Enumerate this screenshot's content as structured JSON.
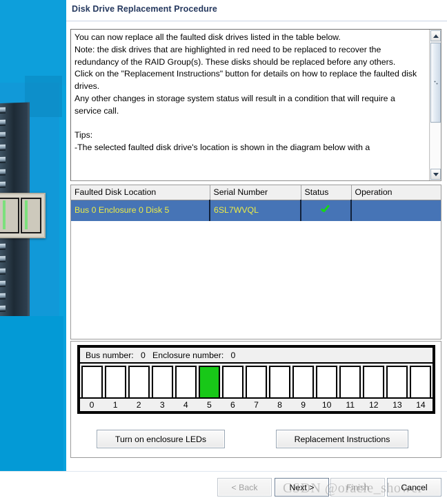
{
  "window": {
    "title": "Disk Drive Replacement Procedure"
  },
  "instructions": {
    "text": "You can now replace all the faulted disk drives listed in the table below.\nNote: the disk drives that are highlighted in red need to be replaced to recover the redundancy of the RAID Group(s). These disks should be replaced before any others.\nClick on the \"Replacement Instructions\" button for details on how to replace the faulted disk drives.\nAny other changes in storage system status will result in a condition that will require a service call.\n\nTips:\n-The selected faulted disk drive's location is shown in the diagram below with a"
  },
  "scrollbar": {
    "up_icon": "chevron-up-icon",
    "down_icon": "chevron-down-icon",
    "grip_icon": "grip-dots-icon"
  },
  "table": {
    "columns": [
      "Faulted Disk Location",
      "Serial Number",
      "Status",
      "Operation"
    ],
    "rows": [
      {
        "location": "Bus 0 Enclosure 0 Disk 5",
        "serial": "6SL7WVQL",
        "status_icon": "green-check-icon",
        "operation": "",
        "selected": true
      }
    ]
  },
  "enclosure": {
    "bus_label": "Bus number:",
    "bus_value": "0",
    "enclosure_label": "Enclosure number:",
    "enclosure_value": "0",
    "header_text": "Bus number:   0   Enclosure number:   0",
    "slot_labels": [
      "0",
      "1",
      "2",
      "3",
      "4",
      "5",
      "6",
      "7",
      "8",
      "9",
      "10",
      "11",
      "12",
      "13",
      "14"
    ],
    "active_slot": 5,
    "active_color": "#18c818"
  },
  "actions": {
    "leds_label": "Turn on enclosure LEDs",
    "instructions_label": "Replacement Instructions"
  },
  "footer": {
    "back_label": "< Back",
    "next_label": "Next >",
    "finish_label": "Finish",
    "cancel_label": "Cancel",
    "back_enabled": false,
    "finish_enabled": false
  },
  "watermark": {
    "text": "CSDN @oracle_shower"
  },
  "theme": {
    "banner_blue": "#0aa2dd",
    "title_color": "#25385e",
    "selection_blue": "#4674b6",
    "selection_text_yellow": "#ecec46",
    "status_green": "#16d816"
  }
}
